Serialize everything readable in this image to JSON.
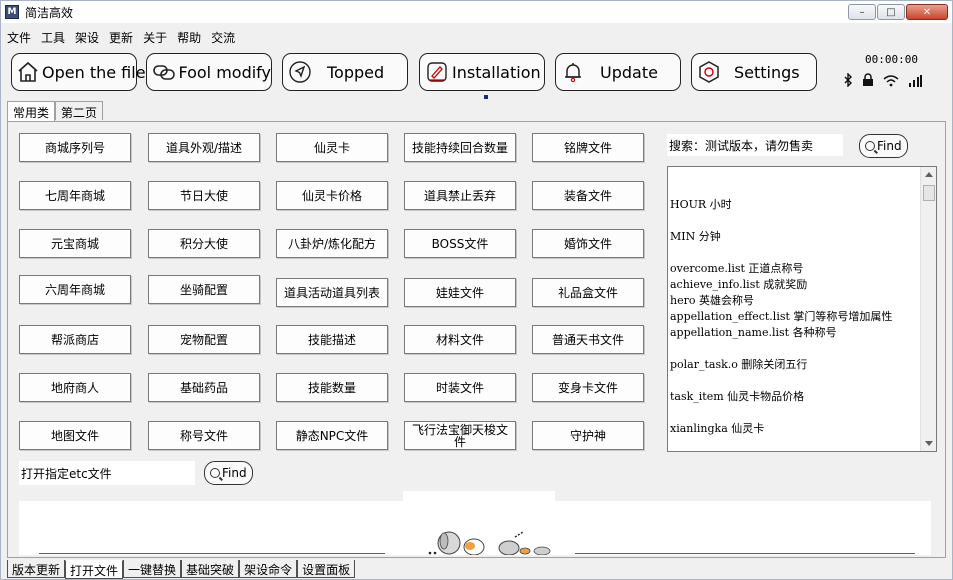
{
  "window": {
    "title": "简洁高效",
    "app_icon": "app-logo-icon",
    "app_icon_glyph": "M"
  },
  "menu": [
    "文件",
    "工具",
    "架设",
    "更新",
    "关于",
    "帮助",
    "交流"
  ],
  "toolbar": {
    "buttons": [
      {
        "label": "Open the file",
        "icon": "house-icon"
      },
      {
        "label": "Fool modify",
        "icon": "link-icon"
      },
      {
        "label": "Topped",
        "icon": "navigation-arrow-icon"
      },
      {
        "label": "Installation",
        "icon": "pencil-square-icon"
      },
      {
        "label": "Update",
        "icon": "bell-icon"
      },
      {
        "label": "Settings",
        "icon": "hexagon-gear-icon"
      }
    ]
  },
  "status": {
    "clock": "00:00:00",
    "icons": [
      "bluetooth-icon",
      "lock-icon",
      "wifi-icon",
      "signal-bars-icon"
    ]
  },
  "tabs_top": [
    {
      "label": "常用类",
      "active": true
    },
    {
      "label": "第二页",
      "active": false
    }
  ],
  "grid_buttons": [
    [
      "商城序列号",
      "道具外观/描述",
      "仙灵卡",
      "技能持续回合数量",
      "铭牌文件"
    ],
    [
      "七周年商城",
      "节日大使",
      "仙灵卡价格",
      "道具禁止丢弃",
      "装备文件"
    ],
    [
      "元宝商城",
      "积分大使",
      "八卦炉/炼化配方",
      "BOSS文件",
      "婚饰文件"
    ],
    [
      "六周年商城",
      "坐骑配置",
      "道具活动道具列表",
      "娃娃文件",
      "礼品盒文件"
    ],
    [
      "帮派商店",
      "宠物配置",
      "技能描述",
      "材料文件",
      "普通天书文件"
    ],
    [
      "地府商人",
      "基础药品",
      "技能数量",
      "时装文件",
      "变身卡文件"
    ],
    [
      "地图文件",
      "称号文件",
      "静态NPC文件",
      "飞行法宝御天梭文件",
      "守护神"
    ]
  ],
  "search": {
    "label": "搜索：测试版本，请勿售卖",
    "find_label": "Find",
    "find_icon": "search-icon"
  },
  "info_lines": [
    "",
    "HOUR 小时",
    "",
    "MIN  分钟",
    "",
    "overcome.list 正道点称号",
    "achieve_info.list 成就奖励",
    "hero  英雄会称号",
    "appellation_effect.list 掌门等称号增加属性",
    "appellation_name.list   各种称号",
    "",
    "polar_task.o   删除关闭五行",
    "",
    "task_item  仙灵卡物品价格",
    "",
    "xianlingka  仙灵卡"
  ],
  "etc_open": {
    "value": "打开指定etc文件",
    "find_label": "Find"
  },
  "mascot": {
    "icon": "cute-animals-illustration-icon"
  },
  "tabs_bottom": [
    {
      "label": "版本更新",
      "active": false
    },
    {
      "label": "打开文件",
      "active": true
    },
    {
      "label": "一键替换",
      "active": false
    },
    {
      "label": "基础突破",
      "active": false
    },
    {
      "label": "架设命令",
      "active": false
    },
    {
      "label": "设置面板",
      "active": false
    }
  ]
}
